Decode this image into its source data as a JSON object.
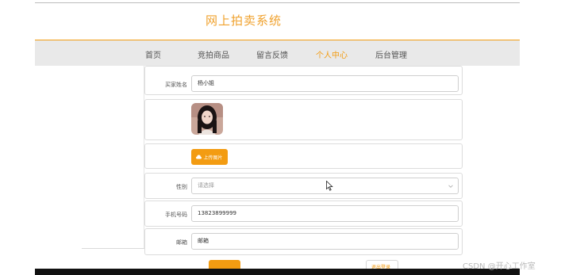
{
  "site": {
    "title": "网上拍卖系统"
  },
  "nav": {
    "items": [
      {
        "label": "首页",
        "active": false
      },
      {
        "label": "竞拍商品",
        "active": false
      },
      {
        "label": "留言反馈",
        "active": false
      },
      {
        "label": "个人中心",
        "active": true
      },
      {
        "label": "后台管理",
        "active": false
      }
    ]
  },
  "form": {
    "buyer_name": {
      "label": "买家姓名",
      "value": "杨小姐"
    },
    "upload": {
      "label": "上传图片"
    },
    "gender": {
      "label": "性别",
      "placeholder": "请选择"
    },
    "phone": {
      "label": "手机号码",
      "value": "13823899999"
    },
    "email": {
      "label": "邮箱",
      "value": "邮箱"
    },
    "actions": {
      "secondary_label": "退出登录"
    }
  },
  "watermark": "CSDN @开心工作室",
  "colors": {
    "accent": "#f39c12",
    "nav_bg": "#e9e9e9"
  },
  "icons": [
    "upload-cloud-icon",
    "chevron-down-icon",
    "mouse-pointer-icon"
  ]
}
